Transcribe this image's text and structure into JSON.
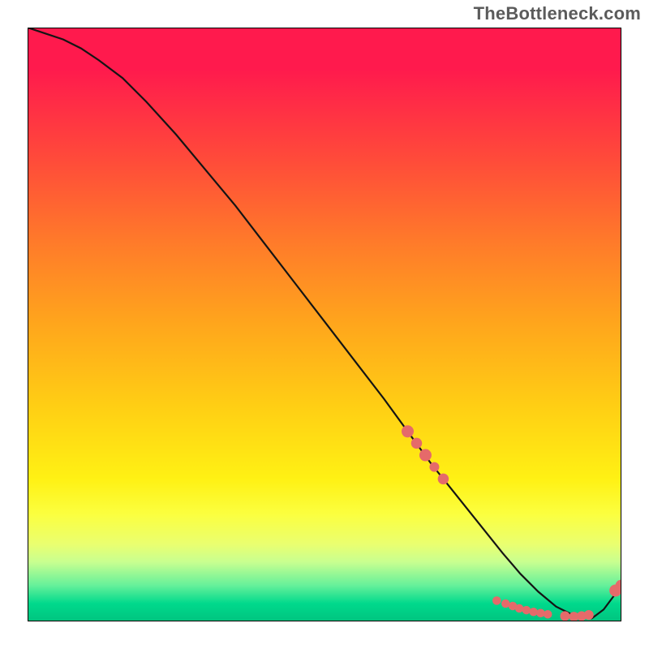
{
  "watermark": "TheBottleneck.com",
  "colors": {
    "marker": "#e56a6a",
    "line": "#141414"
  },
  "chart_data": {
    "type": "line",
    "title": "",
    "xlabel": "",
    "ylabel": "",
    "xlim": [
      0,
      100
    ],
    "ylim": [
      0,
      100
    ],
    "series": [
      {
        "name": "curve",
        "x": [
          0,
          3,
          6,
          9,
          12,
          16,
          20,
          25,
          30,
          35,
          40,
          45,
          50,
          55,
          60,
          64,
          68,
          72,
          76,
          80,
          83,
          86,
          89,
          92,
          95,
          97,
          100
        ],
        "y": [
          100,
          99,
          98,
          96.5,
          94.5,
          91.5,
          87.5,
          82,
          76,
          70,
          63.5,
          57,
          50.5,
          44,
          37.5,
          32,
          26.5,
          21.5,
          16.5,
          11.5,
          8,
          5,
          2.5,
          1,
          0.5,
          2,
          6
        ]
      }
    ],
    "markers": [
      {
        "x": 64,
        "y": 32,
        "r": 1.0
      },
      {
        "x": 65.5,
        "y": 30,
        "r": 0.9
      },
      {
        "x": 67,
        "y": 28,
        "r": 1.0
      },
      {
        "x": 68.5,
        "y": 26,
        "r": 0.8
      },
      {
        "x": 70,
        "y": 24,
        "r": 0.9
      },
      {
        "x": 79,
        "y": 3.5,
        "r": 0.7
      },
      {
        "x": 80.5,
        "y": 3.0,
        "r": 0.7
      },
      {
        "x": 81.7,
        "y": 2.6,
        "r": 0.7
      },
      {
        "x": 82.8,
        "y": 2.2,
        "r": 0.7
      },
      {
        "x": 84.0,
        "y": 1.9,
        "r": 0.7
      },
      {
        "x": 85.2,
        "y": 1.6,
        "r": 0.7
      },
      {
        "x": 86.4,
        "y": 1.4,
        "r": 0.7
      },
      {
        "x": 87.6,
        "y": 1.2,
        "r": 0.7
      },
      {
        "x": 90.5,
        "y": 0.9,
        "r": 0.8
      },
      {
        "x": 92.0,
        "y": 0.8,
        "r": 0.8
      },
      {
        "x": 93.3,
        "y": 0.9,
        "r": 0.8
      },
      {
        "x": 94.5,
        "y": 1.1,
        "r": 0.8
      },
      {
        "x": 99,
        "y": 5.2,
        "r": 1.0
      },
      {
        "x": 100,
        "y": 6.0,
        "r": 1.0
      }
    ]
  }
}
